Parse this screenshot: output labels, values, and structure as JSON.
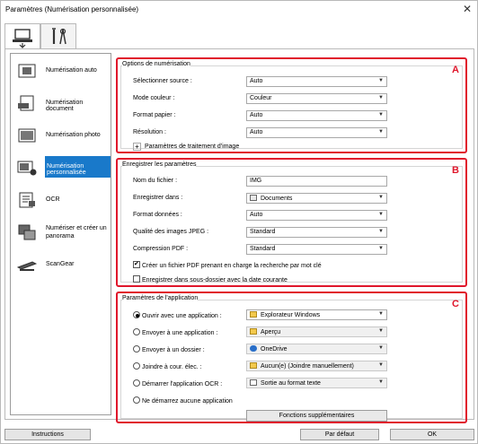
{
  "window": {
    "title": "Paramètres (Numérisation personnalisée)",
    "close": "✕"
  },
  "tabs": [
    {
      "name": "scan-from-computer"
    },
    {
      "name": "general-settings"
    }
  ],
  "sidebar": {
    "items": [
      {
        "label": "Numérisation auto"
      },
      {
        "label": "Numérisation document"
      },
      {
        "label": "Numérisation photo"
      },
      {
        "label": "Numérisation personnalisée",
        "selected": true
      },
      {
        "label": "OCR"
      },
      {
        "label": "Numériser et créer un panorama"
      },
      {
        "label": "ScanGear"
      }
    ]
  },
  "scan_options": {
    "title": "Options de numérisation",
    "marker": "A",
    "source_label": "Sélectionner source :",
    "source_value": "Auto",
    "color_label": "Mode couleur :",
    "color_value": "Couleur",
    "paper_label": "Format papier :",
    "paper_value": "Auto",
    "resolution_label": "Résolution :",
    "resolution_value": "Auto",
    "image_processing_label": "Paramètres de traitement d'image"
  },
  "save_settings": {
    "title": "Enregistrer les paramètres",
    "marker": "B",
    "filename_label": "Nom du fichier :",
    "filename_value": "IMG",
    "save_in_label": "Enregistrer dans :",
    "save_in_value": "Documents",
    "format_label": "Format données :",
    "format_value": "Auto",
    "jpeg_label": "Qualité des images JPEG :",
    "jpeg_value": "Standard",
    "pdf_label": "Compression PDF :",
    "pdf_value": "Standard",
    "searchable_pdf_label": "Créer un fichier PDF prenant en charge la recherche par mot clé",
    "searchable_pdf_checked": true,
    "subfolder_label": "Enregistrer dans sous-dossier avec la date courante",
    "subfolder_checked": false
  },
  "app_settings": {
    "title": "Paramètres de l'application",
    "marker": "C",
    "open_app_label": "Ouvrir avec une application :",
    "open_app_value": "Explorateur Windows",
    "open_app_selected": true,
    "send_app_label": "Envoyer à une application :",
    "send_app_value": "Aperçu",
    "send_folder_label": "Envoyer à un dossier :",
    "send_folder_value": "OneDrive",
    "email_label": "Joindre à cour. élec. :",
    "email_value": "Aucun(e) (Joindre manuellement)",
    "ocr_label": "Démarrer l'application OCR :",
    "ocr_value": "Sortie au format texte",
    "no_app_label": "Ne démarrez aucune application",
    "more_functions_label": "Fonctions supplémentaires"
  },
  "footer": {
    "instructions_label": "Instructions",
    "default_label": "Par défaut",
    "ok_label": "OK"
  },
  "colors": {
    "accent": "#1979ca",
    "marker": "#e0162b"
  }
}
